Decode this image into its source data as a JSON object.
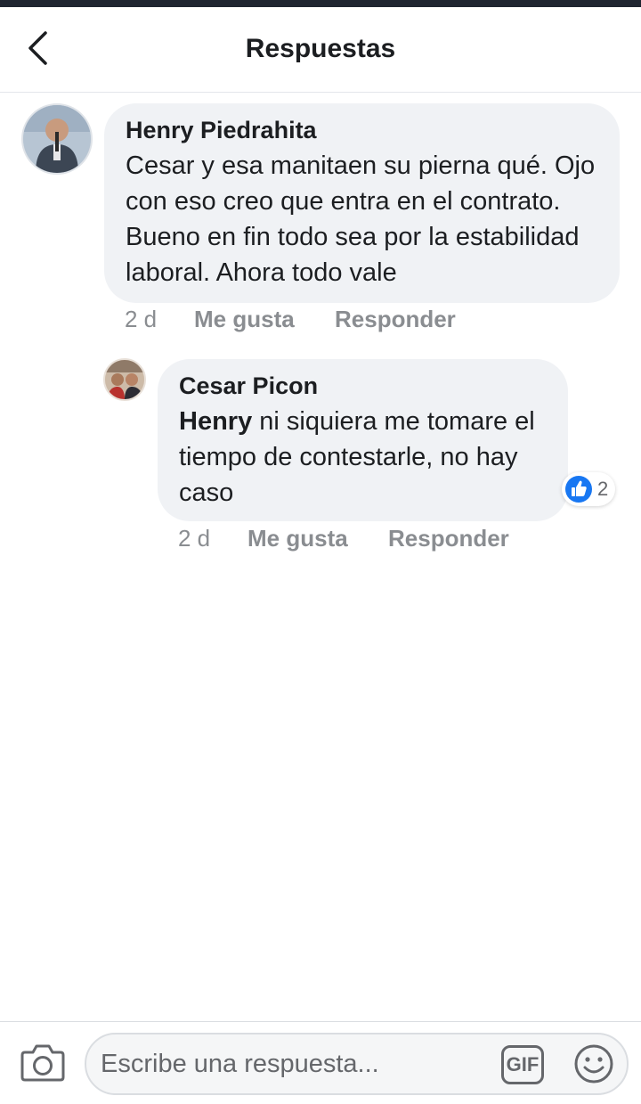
{
  "header": {
    "title": "Respuestas",
    "back_icon": "chevron-left-icon"
  },
  "comments": [
    {
      "author": "Henry Piedrahita",
      "text": "Cesar y esa manitaen su pierna qué. Ojo con eso creo que entra en el contrato. Bueno en fin todo sea por la estabilidad laboral.  Ahora todo vale",
      "time": "2 d",
      "like_label": "Me gusta",
      "reply_label": "Responder"
    },
    {
      "author": "Cesar Picon",
      "mention": "Henry",
      "text": " ni siquiera me tomare el tiempo de contestarle, no hay caso",
      "time": "2 d",
      "like_label": "Me gusta",
      "reply_label": "Responder",
      "reaction": {
        "icon": "thumbs-up-icon",
        "count": "2",
        "color": "#1877f2"
      }
    }
  ],
  "composer": {
    "placeholder": "Escribe una respuesta...",
    "gif_label": "GIF",
    "camera_icon": "camera-icon",
    "emoji_icon": "smiley-icon"
  },
  "colors": {
    "bubble": "#f0f2f5",
    "meta_text": "#8a8d91",
    "like_blue": "#1877f2"
  }
}
